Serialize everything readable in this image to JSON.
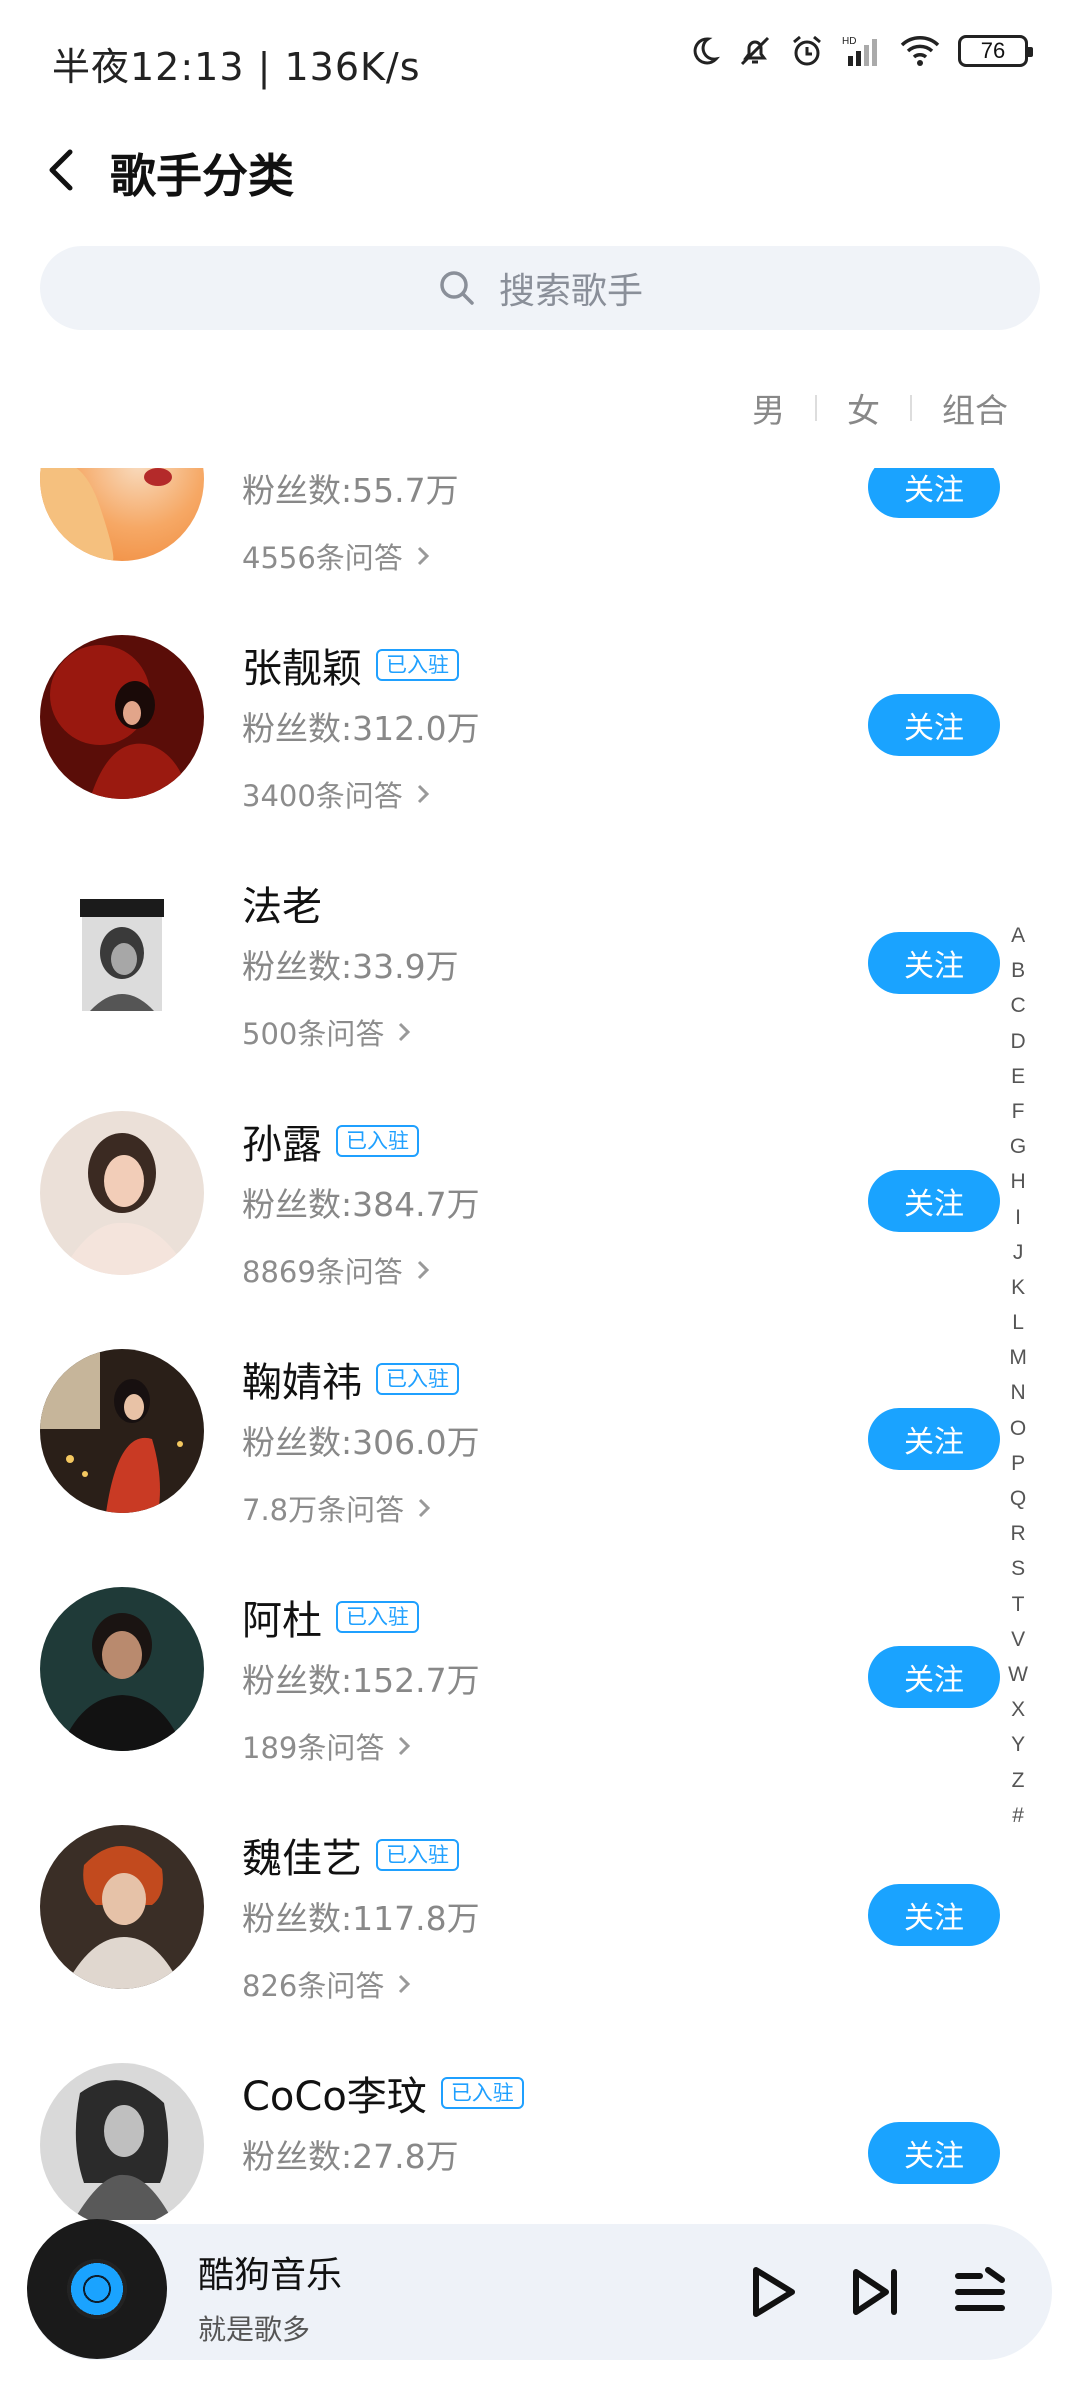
{
  "status_bar": {
    "time": "半夜12:13 | 136K/s",
    "battery": "76"
  },
  "header": {
    "title": "歌手分类"
  },
  "search": {
    "placeholder": "搜索歌手"
  },
  "filters": [
    "男",
    "女",
    "组合"
  ],
  "singers": [
    {
      "name": "",
      "verified": false,
      "fans": "粉丝数:55.7万",
      "qa": "4556条问答",
      "follow": "关注"
    },
    {
      "name": "张靓颖",
      "verified": true,
      "badge": "已入驻",
      "fans": "粉丝数:312.0万",
      "qa": "3400条问答",
      "follow": "关注"
    },
    {
      "name": "法老",
      "verified": false,
      "fans": "粉丝数:33.9万",
      "qa": "500条问答",
      "follow": "关注"
    },
    {
      "name": "孙露",
      "verified": true,
      "badge": "已入驻",
      "fans": "粉丝数:384.7万",
      "qa": "8869条问答",
      "follow": "关注"
    },
    {
      "name": "鞠婧祎",
      "verified": true,
      "badge": "已入驻",
      "fans": "粉丝数:306.0万",
      "qa": "7.8万条问答",
      "follow": "关注"
    },
    {
      "name": "阿杜",
      "verified": true,
      "badge": "已入驻",
      "fans": "粉丝数:152.7万",
      "qa": "189条问答",
      "follow": "关注"
    },
    {
      "name": "魏佳艺",
      "verified": true,
      "badge": "已入驻",
      "fans": "粉丝数:117.8万",
      "qa": "826条问答",
      "follow": "关注"
    },
    {
      "name": "CoCo李玟",
      "verified": true,
      "badge": "已入驻",
      "fans": "粉丝数:27.8万",
      "qa": "",
      "follow": "关注"
    }
  ],
  "alphabet": [
    "A",
    "B",
    "C",
    "D",
    "E",
    "F",
    "G",
    "H",
    "I",
    "J",
    "K",
    "L",
    "M",
    "N",
    "O",
    "P",
    "Q",
    "R",
    "S",
    "T",
    "V",
    "W",
    "X",
    "Y",
    "Z",
    "#"
  ],
  "player": {
    "title": "酷狗音乐",
    "subtitle": "就是歌多"
  }
}
